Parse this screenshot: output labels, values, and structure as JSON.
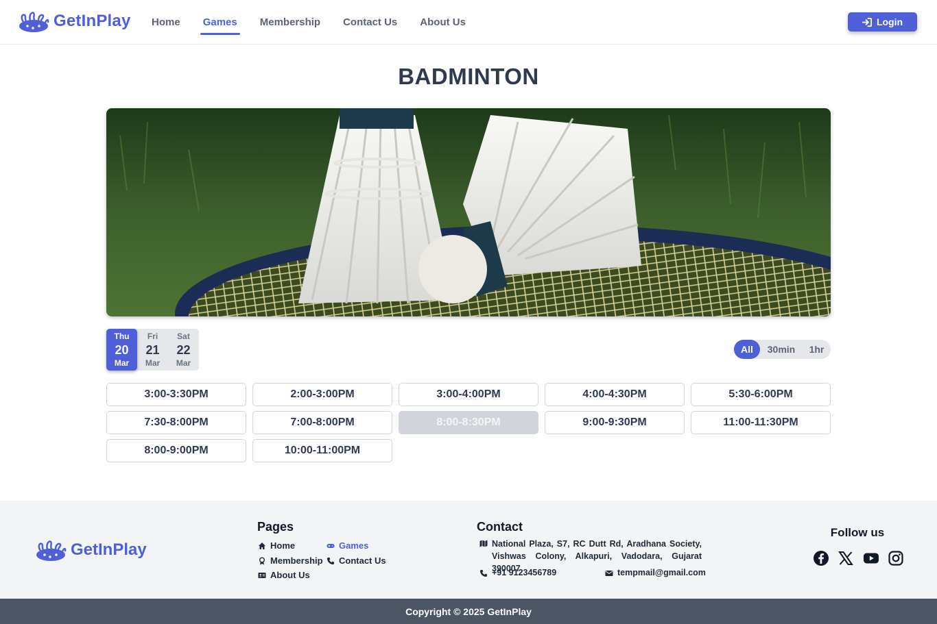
{
  "header": {
    "brand": "GetInPlay",
    "nav": [
      "Home",
      "Games",
      "Membership",
      "Contact Us",
      "About Us"
    ],
    "active_nav": "Games",
    "login_label": "Login"
  },
  "main": {
    "title": "BADMINTON",
    "dates": [
      {
        "dow": "Thu",
        "day": "20",
        "month": "Mar",
        "selected": true
      },
      {
        "dow": "Fri",
        "day": "21",
        "month": "Mar",
        "selected": false
      },
      {
        "dow": "Sat",
        "day": "22",
        "month": "Mar",
        "selected": false
      }
    ],
    "duration_options": [
      "All",
      "30min",
      "1hr"
    ],
    "active_duration": "All",
    "slots": [
      {
        "label": "3:00-3:30PM",
        "available": true
      },
      {
        "label": "2:00-3:00PM",
        "available": true
      },
      {
        "label": "3:00-4:00PM",
        "available": true
      },
      {
        "label": "4:00-4:30PM",
        "available": true
      },
      {
        "label": "5:30-6:00PM",
        "available": true
      },
      {
        "label": "7:30-8:00PM",
        "available": true
      },
      {
        "label": "7:00-8:00PM",
        "available": true
      },
      {
        "label": "8:00-8:30PM",
        "available": false
      },
      {
        "label": "9:00-9:30PM",
        "available": true
      },
      {
        "label": "11:00-11:30PM",
        "available": true
      },
      {
        "label": "8:00-9:00PM",
        "available": true
      },
      {
        "label": "10:00-11:00PM",
        "available": true
      }
    ]
  },
  "footer": {
    "brand": "GetInPlay",
    "pages_title": "Pages",
    "pages": {
      "home": "Home",
      "games": "Games",
      "membership": "Membership",
      "contact_us": "Contact Us",
      "about_us": "About Us"
    },
    "contact_title": "Contact",
    "address": "National Plaza, S7, RC Dutt Rd, Aradhana Society, Vishwas Colony, Alkapuri, Vadodara, Gujarat 390007",
    "phone": "+91 9123456789",
    "email": "tempmail@gmail.com",
    "follow_title": "Follow us",
    "socials": [
      "facebook-icon",
      "x-icon",
      "youtube-icon",
      "instagram-icon"
    ],
    "copyright": "Copyright © 2025 GetInPlay"
  },
  "colors": {
    "accent": "#4f5fd8",
    "text": "#2f3a4f",
    "footer_bg": "#f3f4f6",
    "copyright_bg": "#4b5563",
    "disabled_slot": "#d1d5db"
  }
}
